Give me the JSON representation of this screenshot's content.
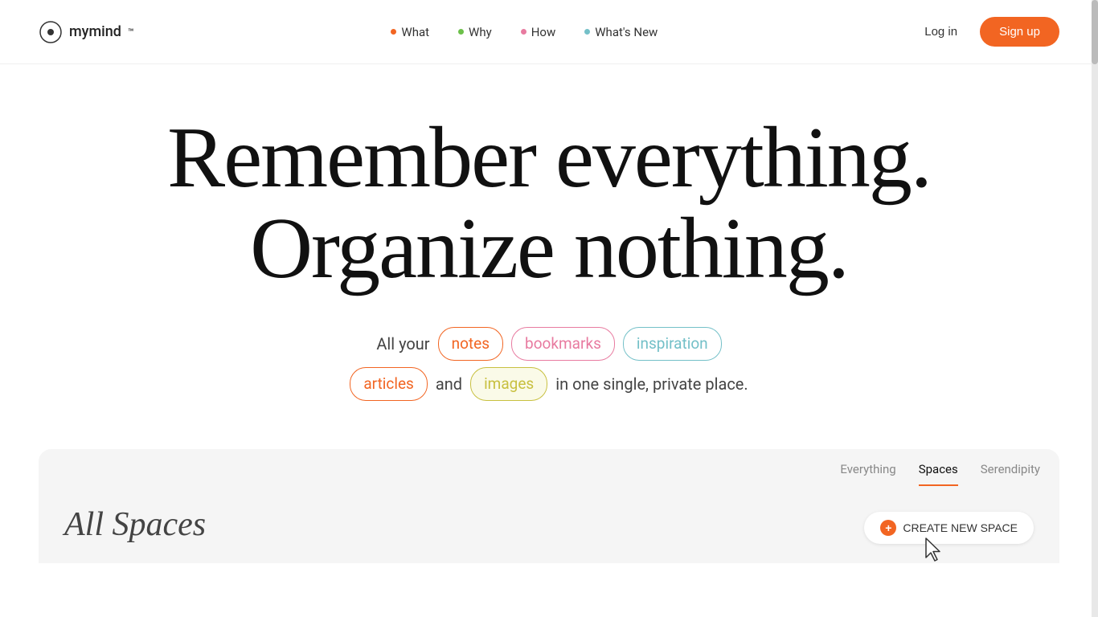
{
  "brand": {
    "name": "mymind",
    "trademark": "™"
  },
  "nav": {
    "items": [
      {
        "label": "What",
        "dot_color": "#f26522"
      },
      {
        "label": "Why",
        "dot_color": "#6cc04a"
      },
      {
        "label": "How",
        "dot_color": "#e87ba0"
      },
      {
        "label": "What's New",
        "dot_color": "#74c0c8"
      }
    ],
    "login_label": "Log in",
    "signup_label": "Sign up"
  },
  "hero": {
    "headline_line1": "Remember everything.",
    "headline_line2": "Organize nothing.",
    "subtext_prefix": "All your",
    "tags": [
      {
        "label": "notes",
        "class": "tag-notes"
      },
      {
        "label": "bookmarks",
        "class": "tag-bookmarks"
      },
      {
        "label": "inspiration",
        "class": "tag-inspiration"
      },
      {
        "label": "articles",
        "class": "tag-articles"
      },
      {
        "label": "images",
        "class": "tag-images"
      }
    ],
    "subtext_and": "and",
    "subtext_suffix": "in one single, private place."
  },
  "app_preview": {
    "tabs": [
      {
        "label": "Everything",
        "active": false
      },
      {
        "label": "Spaces",
        "active": true
      },
      {
        "label": "Serendipity",
        "active": false
      }
    ],
    "all_spaces_title": "All Spaces",
    "create_button_label": "CREATE NEW SPACE"
  }
}
